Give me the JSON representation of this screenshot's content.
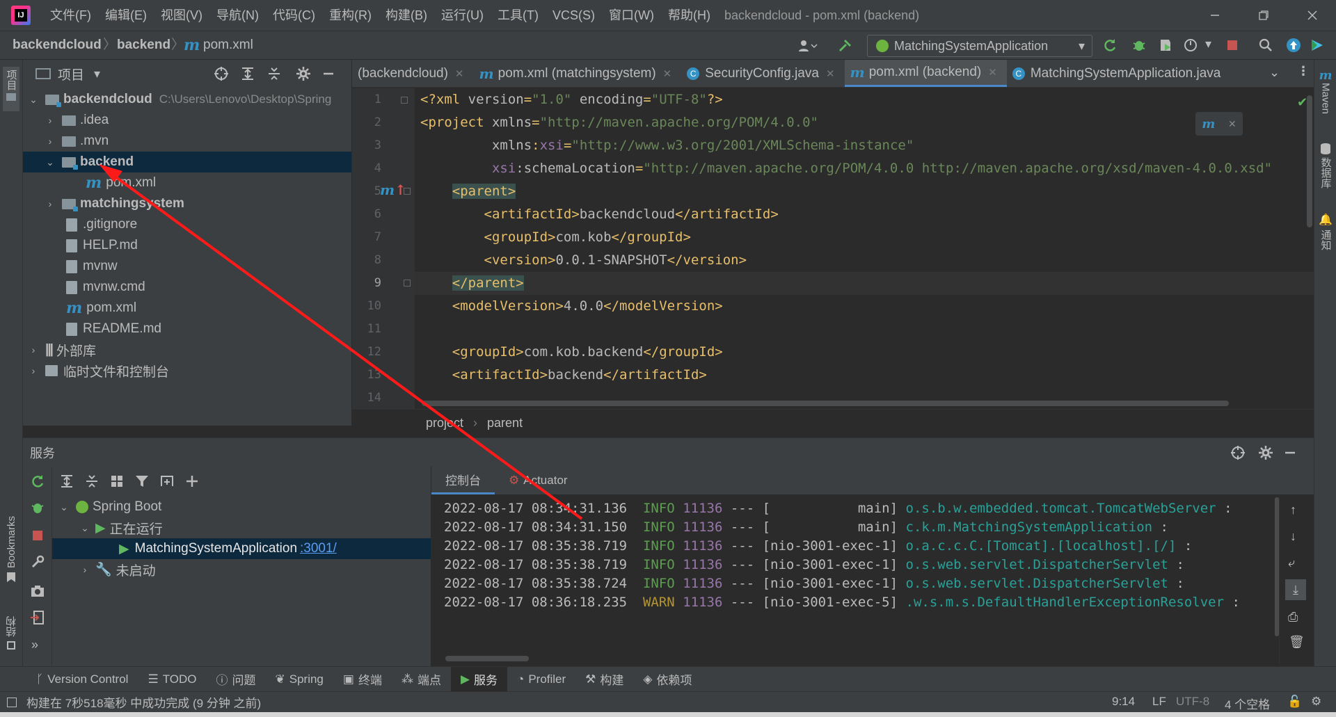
{
  "menubar": {
    "items": [
      "文件(F)",
      "编辑(E)",
      "视图(V)",
      "导航(N)",
      "代码(C)",
      "重构(R)",
      "构建(B)",
      "运行(U)",
      "工具(T)",
      "VCS(S)",
      "窗口(W)",
      "帮助(H)"
    ],
    "window_title": "backendcloud - pom.xml (backend)"
  },
  "navbar": {
    "crumbs": [
      "backendcloud",
      "backend",
      "pom.xml"
    ],
    "run_config": "MatchingSystemApplication"
  },
  "left_strip": {
    "project": "项目",
    "bookmarks": "Bookmarks",
    "structure": "结构"
  },
  "right_strip": {
    "maven": "Maven",
    "database": "数据库",
    "notifications": "通知"
  },
  "project_panel": {
    "title": "项目",
    "tree": [
      {
        "label": "backendcloud",
        "hint": "C:\\Users\\Lenovo\\Desktop\\Spring"
      },
      {
        "label": ".idea"
      },
      {
        "label": ".mvn"
      },
      {
        "label": "backend"
      },
      {
        "label": "pom.xml"
      },
      {
        "label": "matchingsystem"
      },
      {
        "label": ".gitignore"
      },
      {
        "label": "HELP.md"
      },
      {
        "label": "mvnw"
      },
      {
        "label": "mvnw.cmd"
      },
      {
        "label": "pom.xml"
      },
      {
        "label": "README.md"
      },
      {
        "label": "外部库"
      },
      {
        "label": "临时文件和控制台"
      }
    ]
  },
  "editor": {
    "tabs": [
      "(backendcloud)",
      "pom.xml (matchingsystem)",
      "SecurityConfig.java",
      "pom.xml (backend)",
      "MatchingSystemApplication.java"
    ],
    "line_numbers": [
      "1",
      "2",
      "3",
      "4",
      "5",
      "6",
      "7",
      "8",
      "9",
      "10",
      "11",
      "12",
      "13",
      "14"
    ],
    "lines": [
      {
        "parts": [
          [
            "tag",
            "<?xml "
          ],
          [
            "attr",
            "version"
          ],
          [
            "tag",
            "="
          ],
          [
            "str",
            "\"1.0\""
          ],
          [
            "attr",
            " encoding"
          ],
          [
            "tag",
            "="
          ],
          [
            "str",
            "\"UTF-8\""
          ],
          [
            "tag",
            "?>"
          ]
        ]
      },
      {
        "parts": [
          [
            "tag",
            "<project "
          ],
          [
            "attr",
            "xmlns"
          ],
          [
            "tag",
            "="
          ],
          [
            "str",
            "\"http://maven.apache.org/POM/4.0.0\""
          ]
        ]
      },
      {
        "parts": [
          [
            "attr",
            "         xmlns"
          ],
          [
            "tag",
            ":"
          ],
          [
            "ns",
            "xsi"
          ],
          [
            "tag",
            "="
          ],
          [
            "str",
            "\"http://www.w3.org/2001/XMLSchema-instance\""
          ]
        ]
      },
      {
        "parts": [
          [
            "attr",
            "         "
          ],
          [
            "ns",
            "xsi"
          ],
          [
            "attr",
            ":schemaLocation"
          ],
          [
            "tag",
            "="
          ],
          [
            "str",
            "\"http://maven.apache.org/POM/4.0.0 http://maven.apache.org/xsd/maven-4.0.0.xsd\""
          ]
        ]
      },
      {
        "parts": [
          [
            "attr",
            "    "
          ],
          [
            "pt",
            "<parent>"
          ]
        ]
      },
      {
        "parts": [
          [
            "attr",
            "        "
          ],
          [
            "tag",
            "<artifactId>"
          ],
          [
            "attr",
            "backendcloud"
          ],
          [
            "tag",
            "</artifactId>"
          ]
        ]
      },
      {
        "parts": [
          [
            "attr",
            "        "
          ],
          [
            "tag",
            "<groupId>"
          ],
          [
            "attr",
            "com.kob"
          ],
          [
            "tag",
            "</groupId>"
          ]
        ]
      },
      {
        "parts": [
          [
            "attr",
            "        "
          ],
          [
            "tag",
            "<version>"
          ],
          [
            "attr",
            "0.0.1-SNAPSHOT"
          ],
          [
            "tag",
            "</version>"
          ]
        ]
      },
      {
        "parts": [
          [
            "attr",
            "    "
          ],
          [
            "pt",
            "</parent>"
          ]
        ]
      },
      {
        "parts": [
          [
            "attr",
            "    "
          ],
          [
            "tag",
            "<modelVersion>"
          ],
          [
            "attr",
            "4.0.0"
          ],
          [
            "tag",
            "</modelVersion>"
          ]
        ]
      },
      {
        "parts": [
          [
            "attr",
            ""
          ]
        ]
      },
      {
        "parts": [
          [
            "attr",
            "    "
          ],
          [
            "tag",
            "<groupId>"
          ],
          [
            "attr",
            "com.kob.backend"
          ],
          [
            "tag",
            "</groupId>"
          ]
        ]
      },
      {
        "parts": [
          [
            "attr",
            "    "
          ],
          [
            "tag",
            "<artifactId>"
          ],
          [
            "attr",
            "backend"
          ],
          [
            "tag",
            "</artifactId>"
          ]
        ]
      },
      {
        "parts": [
          [
            "attr",
            ""
          ]
        ]
      }
    ],
    "breadcrumb": [
      "project",
      "parent"
    ]
  },
  "services": {
    "title": "服务",
    "tree": [
      {
        "label": "Spring Boot"
      },
      {
        "label": "正在运行"
      },
      {
        "label": "MatchingSystemApplication",
        "link": ":3001/"
      },
      {
        "label": "未启动"
      }
    ],
    "console_tabs": [
      "控制台",
      "Actuator"
    ],
    "log": [
      {
        "ts": "2022-08-17 08:34:31.136",
        "level": "INFO",
        "pid": "11136",
        "thread": "[           main]",
        "logger": "o.s.b.w.embedded.tomcat.TomcatWebServer"
      },
      {
        "ts": "2022-08-17 08:34:31.150",
        "level": "INFO",
        "pid": "11136",
        "thread": "[           main]",
        "logger": "c.k.m.MatchingSystemApplication"
      },
      {
        "ts": "2022-08-17 08:35:38.719",
        "level": "INFO",
        "pid": "11136",
        "thread": "[nio-3001-exec-1]",
        "logger": "o.a.c.c.C.[Tomcat].[localhost].[/]"
      },
      {
        "ts": "2022-08-17 08:35:38.719",
        "level": "INFO",
        "pid": "11136",
        "thread": "[nio-3001-exec-1]",
        "logger": "o.s.web.servlet.DispatcherServlet"
      },
      {
        "ts": "2022-08-17 08:35:38.724",
        "level": "INFO",
        "pid": "11136",
        "thread": "[nio-3001-exec-1]",
        "logger": "o.s.web.servlet.DispatcherServlet"
      },
      {
        "ts": "2022-08-17 08:36:18.235",
        "level": "WARN",
        "pid": "11136",
        "thread": "[nio-3001-exec-5]",
        "logger": ".w.s.m.s.DefaultHandlerExceptionResolver"
      }
    ]
  },
  "bottom_tools": [
    "Version Control",
    "TODO",
    "问题",
    "Spring",
    "终端",
    "端点",
    "服务",
    "Profiler",
    "构建",
    "依赖项"
  ],
  "status": {
    "message": "构建在 7秒518毫秒 中成功完成 (9 分钟 之前)",
    "position": "9:14",
    "line_sep": "LF",
    "encoding": "UTF-8",
    "indent": "4 个空格"
  },
  "colors": {
    "accent": "#4a88c7",
    "annotation_arrow": "#ff1a1a",
    "selection": "#0d293e"
  }
}
